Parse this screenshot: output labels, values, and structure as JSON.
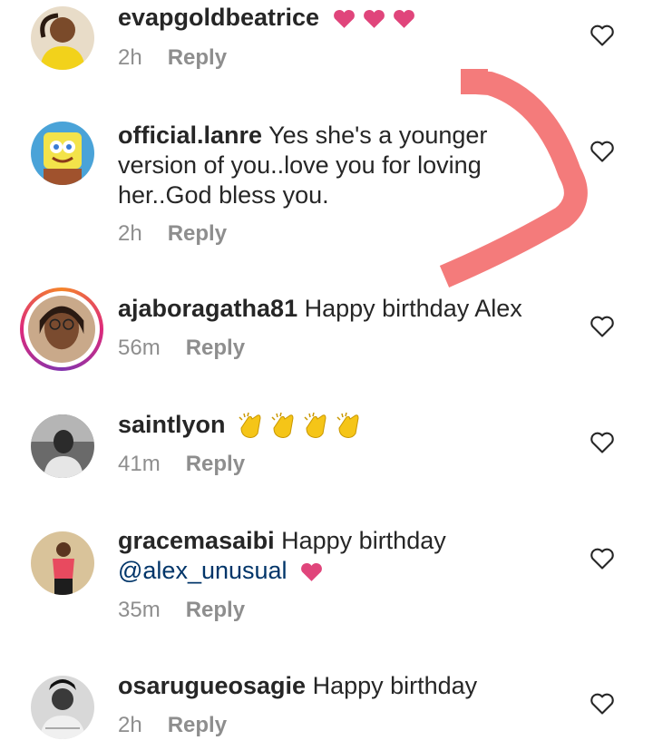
{
  "comments": [
    {
      "username": "evapgoldbeatrice",
      "text": "",
      "emojis": [
        "pink-heart",
        "pink-heart",
        "pink-heart"
      ],
      "time": "2h",
      "reply": "Reply"
    },
    {
      "username": "official.lanre",
      "text": "Yes she's a younger version of you..love you for loving her..God bless you.",
      "time": "2h",
      "reply": "Reply"
    },
    {
      "username": "ajaboragatha81",
      "text": "Happy birthday Alex",
      "time": "56m",
      "reply": "Reply",
      "has_story_ring": true
    },
    {
      "username": "saintlyon",
      "text": "",
      "emojis": [
        "clapping-hands",
        "clapping-hands",
        "clapping-hands",
        "clapping-hands"
      ],
      "time": "41m",
      "reply": "Reply"
    },
    {
      "username": "gracemasaibi",
      "text": "Happy birthday",
      "mention": "@alex_unusual",
      "emojis": [
        "pink-heart"
      ],
      "time": "35m",
      "reply": "Reply"
    },
    {
      "username": "osarugueosagie",
      "text": "Happy birthday",
      "time": "2h",
      "reply": "Reply"
    }
  ],
  "colors": {
    "text": "#262626",
    "meta": "#8e8e8e",
    "mention": "#003569",
    "heart_emoji": "#e0457b",
    "annotation_arrow": "#f47b7b"
  }
}
